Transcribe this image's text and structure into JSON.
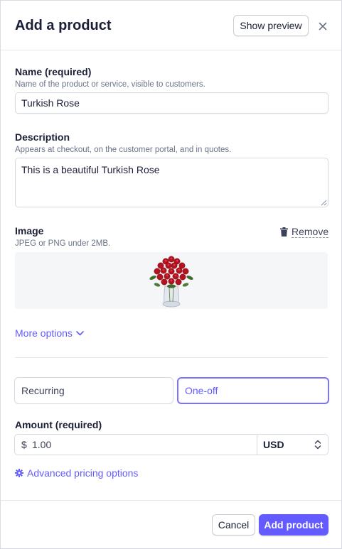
{
  "header": {
    "title": "Add a product",
    "preview_label": "Show preview",
    "close_icon": "close-icon"
  },
  "name": {
    "label": "Name (required)",
    "help": "Name of the product or service, visible to customers.",
    "value": "Turkish Rose"
  },
  "description": {
    "label": "Description",
    "help": "Appears at checkout, on the customer portal, and in quotes.",
    "value": "This is a beautiful Turkish Rose"
  },
  "image": {
    "label": "Image",
    "help": "JPEG or PNG under 2MB.",
    "remove_label": "Remove",
    "remove_icon": "trash-icon",
    "preview_icon": "rose-bouquet-image"
  },
  "more_options": {
    "label": "More options",
    "icon": "chevron-down-icon"
  },
  "pricing": {
    "recurring_label": "Recurring",
    "oneoff_label": "One-off",
    "selected": "One-off"
  },
  "amount": {
    "label": "Amount (required)",
    "currency_symbol": "$",
    "value": "1.00",
    "currency": "USD"
  },
  "advanced": {
    "label": "Advanced pricing options",
    "icon": "gear-icon"
  },
  "footer": {
    "cancel_label": "Cancel",
    "add_label": "Add product"
  },
  "colors": {
    "accent": "#635bff",
    "text": "#1a1f36",
    "muted": "#697386",
    "border": "#d5d9e0"
  }
}
